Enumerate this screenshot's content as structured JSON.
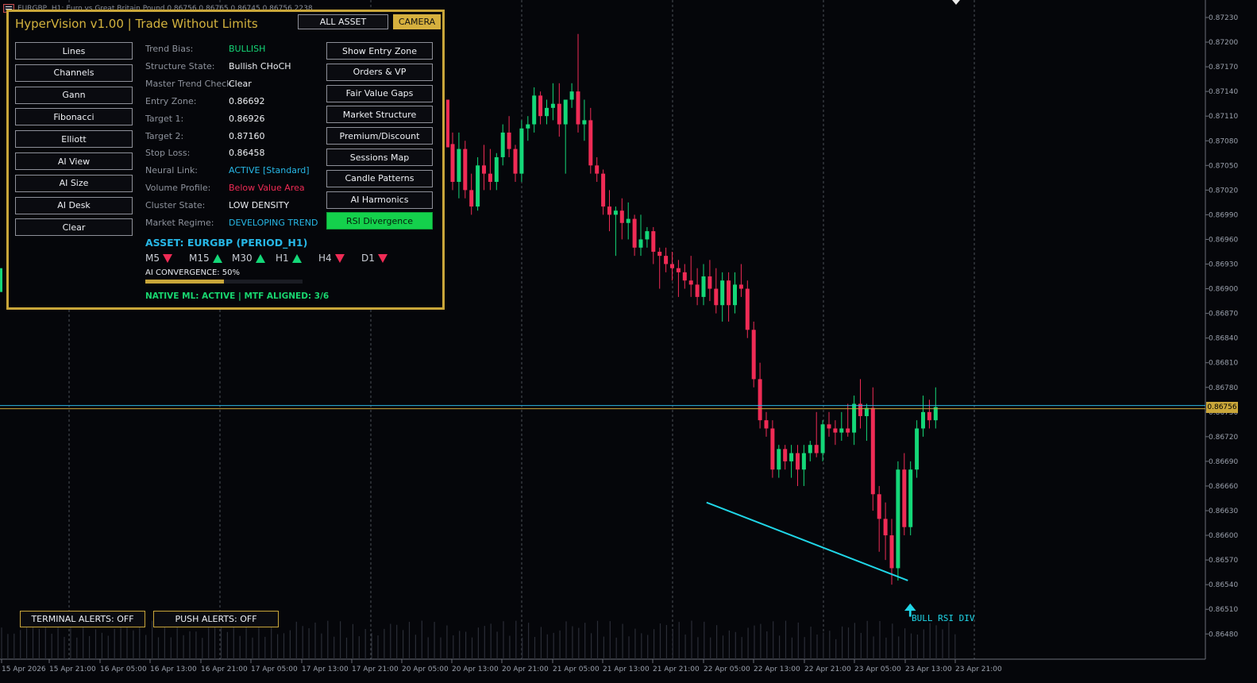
{
  "window": {
    "title": "EURGBP, H1: Euro vs Great Britain Pound 0.86756 0.86765 0.86745 0.86756 2238"
  },
  "panel": {
    "title": "HyperVision v1.00 | Trade Without Limits",
    "all_asset_label": "ALL ASSET",
    "camera_label": "CAMERA",
    "left_buttons": [
      "Lines",
      "Channels",
      "Gann",
      "Fibonacci",
      "Elliott",
      "AI View",
      "AI Size",
      "AI Desk",
      "Clear"
    ],
    "right_buttons": [
      "Show Entry Zone",
      "Orders & VP",
      "Fair Value Gaps",
      "Market Structure",
      "Premium/Discount",
      "Sessions Map",
      "Candle Patterns",
      "AI Harmonics",
      "RSI Divergence"
    ],
    "active_right_button": "RSI Divergence",
    "info": [
      {
        "label": "Trend Bias:",
        "value": "BULLISH",
        "color": "#14d778"
      },
      {
        "label": "Structure State:",
        "value": "Bullish CHoCH",
        "color": "#eef0f4"
      },
      {
        "label": "Master Trend Check:",
        "value": "Clear",
        "color": "#eef0f4"
      },
      {
        "label": "Entry Zone:",
        "value": "0.86692",
        "color": "#eef0f4"
      },
      {
        "label": "Target 1:",
        "value": "0.86926",
        "color": "#eef0f4"
      },
      {
        "label": "Target 2:",
        "value": "0.87160",
        "color": "#eef0f4"
      },
      {
        "label": "Stop Loss:",
        "value": "0.86458",
        "color": "#eef0f4"
      },
      {
        "label": "Neural Link:",
        "value": "ACTIVE [Standard]",
        "color": "#27b7e6"
      },
      {
        "label": "Volume Profile:",
        "value": "Below Value Area",
        "color": "#ef2b55"
      },
      {
        "label": "Cluster State:",
        "value": "LOW DENSITY",
        "color": "#eef0f4"
      },
      {
        "label": "Market Regime:",
        "value": "DEVELOPING TREND",
        "color": "#27b7e6"
      }
    ],
    "asset_line": "ASSET: EURGBP (PERIOD_H1)",
    "timeframes": [
      {
        "name": "M5",
        "dir": "down"
      },
      {
        "name": "M15",
        "dir": "up"
      },
      {
        "name": "M30",
        "dir": "up"
      },
      {
        "name": "H1",
        "dir": "up"
      },
      {
        "name": "H4",
        "dir": "down"
      },
      {
        "name": "D1",
        "dir": "down"
      }
    ],
    "convergence_label": "AI CONVERGENCE: 50%",
    "convergence_value": 0.5,
    "native_status": "NATIVE ML: ACTIVE | MTF ALIGNED: 3/6"
  },
  "alerts": {
    "terminal": "TERMINAL ALERTS: OFF",
    "push": "PUSH ALERTS: OFF"
  },
  "divergence_label": "BULL RSI DIV",
  "current_price": "0.86756",
  "colors": {
    "bull": "#14d778",
    "bear": "#ef2b55",
    "accent": "#c9a63a",
    "cyan": "#20d6e8"
  },
  "chart_data": {
    "type": "candlestick",
    "symbol": "EURGBP",
    "period": "H1",
    "y_ticks": [
      "0.87230",
      "0.87200",
      "0.87170",
      "0.87140",
      "0.87110",
      "0.87080",
      "0.87050",
      "0.87020",
      "0.86990",
      "0.86960",
      "0.86930",
      "0.86900",
      "0.86870",
      "0.86840",
      "0.86810",
      "0.86780",
      "0.86750",
      "0.86720",
      "0.86690",
      "0.86660",
      "0.86630",
      "0.86600",
      "0.86570",
      "0.86540",
      "0.86510",
      "0.86480"
    ],
    "x_ticks": [
      "15 Apr 2026",
      "15 Apr 21:00",
      "16 Apr 05:00",
      "16 Apr 13:00",
      "16 Apr 21:00",
      "17 Apr 05:00",
      "17 Apr 13:00",
      "17 Apr 21:00",
      "20 Apr 05:00",
      "20 Apr 13:00",
      "20 Apr 21:00",
      "21 Apr 05:00",
      "21 Apr 13:00",
      "21 Apr 21:00",
      "22 Apr 05:00",
      "22 Apr 13:00",
      "22 Apr 21:00",
      "23 Apr 05:00",
      "23 Apr 13:00",
      "23 Apr 21:00"
    ],
    "candles": [
      {
        "o": 0.87076,
        "h": 0.8709,
        "l": 0.8702,
        "c": 0.8703
      },
      {
        "o": 0.8703,
        "h": 0.8709,
        "l": 0.8701,
        "c": 0.8707
      },
      {
        "o": 0.8707,
        "h": 0.8708,
        "l": 0.8701,
        "c": 0.8702
      },
      {
        "o": 0.8702,
        "h": 0.8704,
        "l": 0.8699,
        "c": 0.87
      },
      {
        "o": 0.87,
        "h": 0.8706,
        "l": 0.86995,
        "c": 0.8705
      },
      {
        "o": 0.8705,
        "h": 0.87075,
        "l": 0.8702,
        "c": 0.8704
      },
      {
        "o": 0.8704,
        "h": 0.8707,
        "l": 0.8702,
        "c": 0.8703
      },
      {
        "o": 0.8703,
        "h": 0.87065,
        "l": 0.8702,
        "c": 0.8706
      },
      {
        "o": 0.8706,
        "h": 0.871,
        "l": 0.8705,
        "c": 0.8709
      },
      {
        "o": 0.8709,
        "h": 0.8711,
        "l": 0.8706,
        "c": 0.8707
      },
      {
        "o": 0.8707,
        "h": 0.87075,
        "l": 0.8703,
        "c": 0.8704
      },
      {
        "o": 0.8704,
        "h": 0.87105,
        "l": 0.8703,
        "c": 0.87095
      },
      {
        "o": 0.87095,
        "h": 0.8711,
        "l": 0.8708,
        "c": 0.871
      },
      {
        "o": 0.871,
        "h": 0.87145,
        "l": 0.8709,
        "c": 0.87135
      },
      {
        "o": 0.87135,
        "h": 0.8714,
        "l": 0.871,
        "c": 0.8711
      },
      {
        "o": 0.8711,
        "h": 0.8713,
        "l": 0.871,
        "c": 0.8712
      },
      {
        "o": 0.8712,
        "h": 0.8715,
        "l": 0.87105,
        "c": 0.87125
      },
      {
        "o": 0.87125,
        "h": 0.8715,
        "l": 0.87085,
        "c": 0.871
      },
      {
        "o": 0.871,
        "h": 0.8713,
        "l": 0.8704,
        "c": 0.8713
      },
      {
        "o": 0.8713,
        "h": 0.8715,
        "l": 0.8712,
        "c": 0.8714
      },
      {
        "o": 0.8714,
        "h": 0.8721,
        "l": 0.8709,
        "c": 0.871
      },
      {
        "o": 0.871,
        "h": 0.8713,
        "l": 0.8708,
        "c": 0.87105
      },
      {
        "o": 0.87105,
        "h": 0.8712,
        "l": 0.8704,
        "c": 0.8705
      },
      {
        "o": 0.8705,
        "h": 0.8706,
        "l": 0.8703,
        "c": 0.8704
      },
      {
        "o": 0.8704,
        "h": 0.87045,
        "l": 0.8699,
        "c": 0.87
      },
      {
        "o": 0.87,
        "h": 0.8702,
        "l": 0.8697,
        "c": 0.8699
      },
      {
        "o": 0.8699,
        "h": 0.87,
        "l": 0.8694,
        "c": 0.86995
      },
      {
        "o": 0.86995,
        "h": 0.8701,
        "l": 0.8696,
        "c": 0.8698
      },
      {
        "o": 0.8698,
        "h": 0.87005,
        "l": 0.8696,
        "c": 0.86985
      },
      {
        "o": 0.86985,
        "h": 0.8699,
        "l": 0.8694,
        "c": 0.8695
      },
      {
        "o": 0.8695,
        "h": 0.8699,
        "l": 0.8694,
        "c": 0.8696
      },
      {
        "o": 0.8696,
        "h": 0.86975,
        "l": 0.8695,
        "c": 0.8697
      },
      {
        "o": 0.8697,
        "h": 0.86975,
        "l": 0.8693,
        "c": 0.86945
      },
      {
        "o": 0.86945,
        "h": 0.8695,
        "l": 0.869,
        "c": 0.8694
      },
      {
        "o": 0.8694,
        "h": 0.8695,
        "l": 0.8692,
        "c": 0.8693
      },
      {
        "o": 0.8693,
        "h": 0.86945,
        "l": 0.8691,
        "c": 0.86925
      },
      {
        "o": 0.86925,
        "h": 0.86935,
        "l": 0.8689,
        "c": 0.8692
      },
      {
        "o": 0.8692,
        "h": 0.8693,
        "l": 0.869,
        "c": 0.8691
      },
      {
        "o": 0.8691,
        "h": 0.8694,
        "l": 0.8689,
        "c": 0.86905
      },
      {
        "o": 0.86905,
        "h": 0.86925,
        "l": 0.8688,
        "c": 0.8689
      },
      {
        "o": 0.8689,
        "h": 0.8693,
        "l": 0.8688,
        "c": 0.86915
      },
      {
        "o": 0.86915,
        "h": 0.86935,
        "l": 0.86885,
        "c": 0.869
      },
      {
        "o": 0.869,
        "h": 0.86925,
        "l": 0.8687,
        "c": 0.8688
      },
      {
        "o": 0.8688,
        "h": 0.8692,
        "l": 0.8686,
        "c": 0.8691
      },
      {
        "o": 0.8691,
        "h": 0.8692,
        "l": 0.8686,
        "c": 0.8688
      },
      {
        "o": 0.8688,
        "h": 0.8692,
        "l": 0.8687,
        "c": 0.86905
      },
      {
        "o": 0.86905,
        "h": 0.8693,
        "l": 0.8689,
        "c": 0.869
      },
      {
        "o": 0.869,
        "h": 0.8691,
        "l": 0.8684,
        "c": 0.8685
      },
      {
        "o": 0.8685,
        "h": 0.8686,
        "l": 0.8678,
        "c": 0.8679
      },
      {
        "o": 0.8679,
        "h": 0.8681,
        "l": 0.8673,
        "c": 0.8674
      },
      {
        "o": 0.8674,
        "h": 0.8675,
        "l": 0.8672,
        "c": 0.8673
      },
      {
        "o": 0.8673,
        "h": 0.8674,
        "l": 0.8667,
        "c": 0.8668
      },
      {
        "o": 0.8668,
        "h": 0.8671,
        "l": 0.8667,
        "c": 0.86705
      },
      {
        "o": 0.86705,
        "h": 0.8671,
        "l": 0.8668,
        "c": 0.8669
      },
      {
        "o": 0.8669,
        "h": 0.8671,
        "l": 0.8667,
        "c": 0.867
      },
      {
        "o": 0.867,
        "h": 0.8671,
        "l": 0.8666,
        "c": 0.8668
      },
      {
        "o": 0.8668,
        "h": 0.8671,
        "l": 0.8666,
        "c": 0.867
      },
      {
        "o": 0.867,
        "h": 0.86715,
        "l": 0.8669,
        "c": 0.8671
      },
      {
        "o": 0.8671,
        "h": 0.8675,
        "l": 0.86695,
        "c": 0.867
      },
      {
        "o": 0.867,
        "h": 0.8674,
        "l": 0.8669,
        "c": 0.86735
      },
      {
        "o": 0.86735,
        "h": 0.8675,
        "l": 0.8672,
        "c": 0.8673
      },
      {
        "o": 0.8673,
        "h": 0.8674,
        "l": 0.8671,
        "c": 0.86725
      },
      {
        "o": 0.86725,
        "h": 0.8675,
        "l": 0.86715,
        "c": 0.8673
      },
      {
        "o": 0.8673,
        "h": 0.8676,
        "l": 0.8672,
        "c": 0.86725
      },
      {
        "o": 0.86725,
        "h": 0.8677,
        "l": 0.8671,
        "c": 0.8676
      },
      {
        "o": 0.8676,
        "h": 0.8679,
        "l": 0.8673,
        "c": 0.86745
      },
      {
        "o": 0.86745,
        "h": 0.8676,
        "l": 0.86715,
        "c": 0.86755
      },
      {
        "o": 0.86755,
        "h": 0.8678,
        "l": 0.8663,
        "c": 0.8665
      },
      {
        "o": 0.8665,
        "h": 0.8666,
        "l": 0.8658,
        "c": 0.8662
      },
      {
        "o": 0.8662,
        "h": 0.8664,
        "l": 0.8657,
        "c": 0.866
      },
      {
        "o": 0.866,
        "h": 0.8662,
        "l": 0.8654,
        "c": 0.8656
      },
      {
        "o": 0.8656,
        "h": 0.8669,
        "l": 0.86545,
        "c": 0.8668
      },
      {
        "o": 0.8668,
        "h": 0.867,
        "l": 0.866,
        "c": 0.8661
      },
      {
        "o": 0.8661,
        "h": 0.8669,
        "l": 0.866,
        "c": 0.8668
      },
      {
        "o": 0.8668,
        "h": 0.8674,
        "l": 0.8667,
        "c": 0.8673
      },
      {
        "o": 0.8673,
        "h": 0.8677,
        "l": 0.8672,
        "c": 0.8675
      },
      {
        "o": 0.8675,
        "h": 0.86765,
        "l": 0.8673,
        "c": 0.8674
      },
      {
        "o": 0.8674,
        "h": 0.8678,
        "l": 0.8673,
        "c": 0.86756
      }
    ],
    "divergence_line": {
      "from_index": 62,
      "from_price": 0.8664,
      "to_index": 77,
      "to_price": 0.86545
    },
    "current_price": 0.86756
  }
}
